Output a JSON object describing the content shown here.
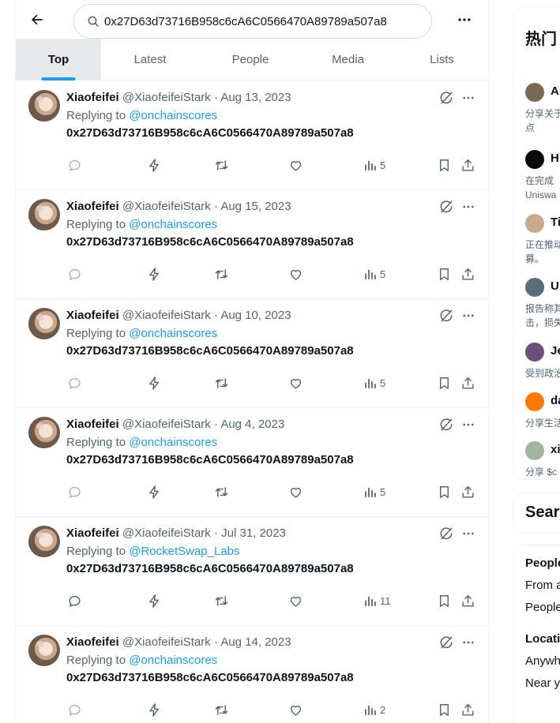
{
  "search": {
    "query": "0x27D63d73716B958c6cA6C0566470A89789a507a8"
  },
  "tabs": [
    "Top",
    "Latest",
    "People",
    "Media",
    "Lists"
  ],
  "active_tab": "Top",
  "colors": {
    "accent": "#1d9bf0",
    "text": "#0f1419",
    "muted": "#536471",
    "border": "#eff3f4"
  },
  "tweets": [
    {
      "name": "Xiaofeifei",
      "handle": "@XiaofeifeiStark",
      "date": "Aug 13, 2023",
      "replying_label": "Replying to",
      "mention": "@onchainscores",
      "body": "0x27D63d73716B958c6cA6C0566470A89789a507a8",
      "views": "5"
    },
    {
      "name": "Xiaofeifei",
      "handle": "@XiaofeifeiStark",
      "date": "Aug 15, 2023",
      "replying_label": "Replying to",
      "mention": "@onchainscores",
      "body": "0x27D63d73716B958c6cA6C0566470A89789a507a8",
      "views": "5"
    },
    {
      "name": "Xiaofeifei",
      "handle": "@XiaofeifeiStark",
      "date": "Aug 10, 2023",
      "replying_label": "Replying to",
      "mention": "@onchainscores",
      "body": "0x27D63d73716B958c6cA6C0566470A89789a507a8",
      "views": "5"
    },
    {
      "name": "Xiaofeifei",
      "handle": "@XiaofeifeiStark",
      "date": "Aug 4, 2023",
      "replying_label": "Replying to",
      "mention": "@onchainscores",
      "body": "0x27D63d73716B958c6cA6C0566470A89789a507a8",
      "views": "5"
    },
    {
      "name": "Xiaofeifei",
      "handle": "@XiaofeifeiStark",
      "date": "Jul 31, 2023",
      "replying_label": "Replying to",
      "mention": "@RocketSwap_Labs",
      "body": "0x27D63d73716B958c6cA6C0566470A89789a507a8",
      "views": "11"
    },
    {
      "name": "Xiaofeifei",
      "handle": "@XiaofeifeiStark",
      "date": "Aug 14, 2023",
      "replying_label": "Replying to",
      "mention": "@onchainscores",
      "body": "0x27D63d73716B958c6cA6C0566470A89789a507a8",
      "views": "2"
    }
  ],
  "sidebar": {
    "trending_title": "热门",
    "trends": [
      {
        "name": "Al",
        "desc1": "分享关于",
        "desc2": "点",
        "avatar_color": "#7a6a55"
      },
      {
        "name": "H",
        "desc1": "在完成",
        "desc2": "Uniswa",
        "avatar_color": "#0b0b0b"
      },
      {
        "name": "Ti",
        "desc1": "正在推动",
        "desc2": "募。",
        "avatar_color": "#c9a98a"
      },
      {
        "name": "U",
        "desc1": "报告称其",
        "desc2": "击，损失",
        "avatar_color": "#5a6b7a"
      },
      {
        "name": "Je",
        "desc1": "受到政治",
        "desc2": "",
        "avatar_color": "#6b4f7a"
      },
      {
        "name": "da",
        "desc1": "分享生活",
        "desc2": "",
        "avatar_color": "#ff7a00"
      },
      {
        "name": "xi",
        "desc1": "分享 $c",
        "desc2": "",
        "avatar_color": "#9fb5a0"
      }
    ],
    "search_filters_title": "Sear",
    "people_heading": "People",
    "people_opt1": "From a",
    "people_opt2": "People",
    "location_heading": "Locatio",
    "location_opt1": "Anywh",
    "location_opt2": "Near y"
  }
}
